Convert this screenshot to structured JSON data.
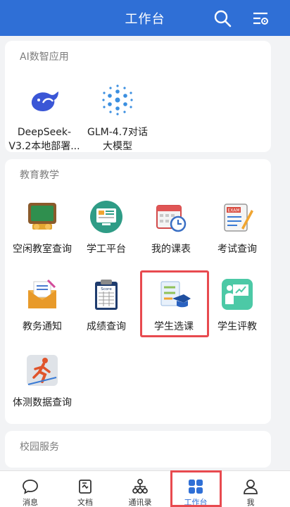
{
  "header": {
    "title": "工作台"
  },
  "ai_section": {
    "title": "AI数智应用",
    "apps": [
      {
        "label": "DeepSeek-V3.2本地部署...",
        "icon": "deepseek-whale-icon"
      },
      {
        "label": "GLM-4.7对话大模型",
        "icon": "glm-dots-icon"
      }
    ]
  },
  "edu_section": {
    "title": "教育教学",
    "apps": [
      {
        "label": "空闲教室查询",
        "icon": "classroom-icon"
      },
      {
        "label": "学工平台",
        "icon": "student-affairs-icon"
      },
      {
        "label": "我的课表",
        "icon": "calendar-clock-icon"
      },
      {
        "label": "考试查询",
        "icon": "exam-icon"
      },
      {
        "label": "教务通知",
        "icon": "mail-notice-icon"
      },
      {
        "label": "成绩查询",
        "icon": "score-sheet-icon"
      },
      {
        "label": "学生选课",
        "icon": "course-select-icon"
      },
      {
        "label": "学生评教",
        "icon": "teaching-evaluation-icon"
      },
      {
        "label": "体测数据查询",
        "icon": "running-icon"
      }
    ]
  },
  "campus_section": {
    "title": "校园服务"
  },
  "tabbar": {
    "tabs": [
      {
        "label": "消息",
        "icon": "chat-bubble-icon"
      },
      {
        "label": "文档",
        "icon": "document-icon"
      },
      {
        "label": "通讯录",
        "icon": "org-chart-icon"
      },
      {
        "label": "工作台",
        "icon": "grid-icon",
        "active": true
      },
      {
        "label": "我",
        "icon": "user-icon"
      }
    ]
  },
  "colors": {
    "primary": "#2f6fd6",
    "highlight": "#e84a4f"
  }
}
